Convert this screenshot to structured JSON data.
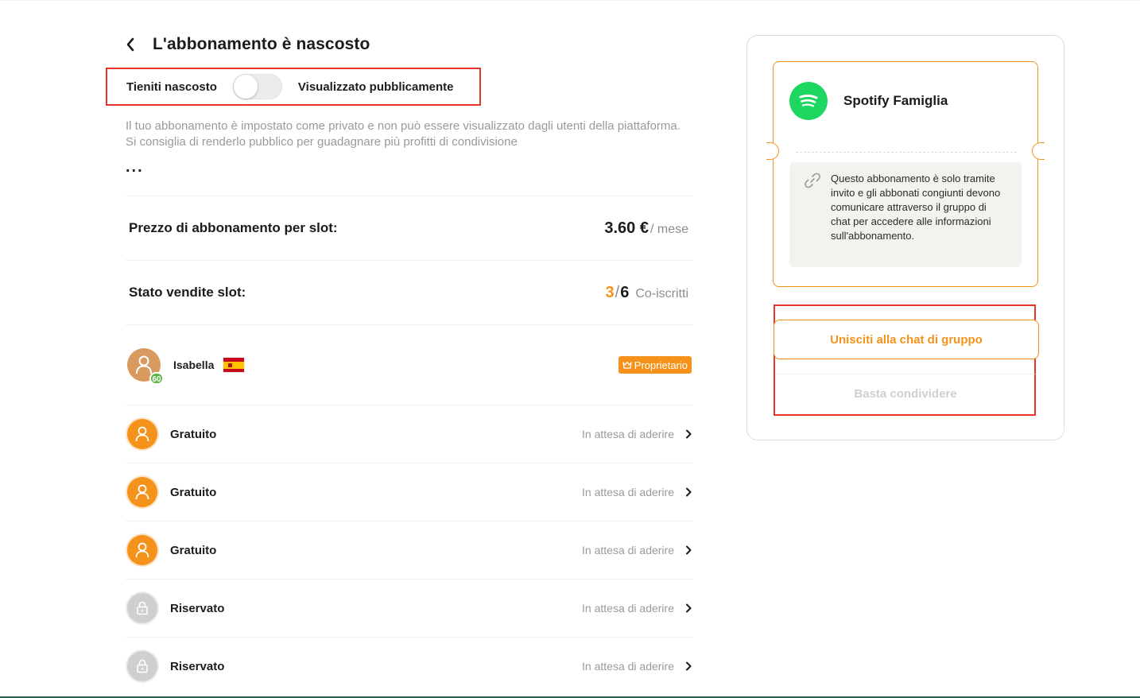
{
  "header": {
    "title": "L'abbonamento è nascosto"
  },
  "visibility": {
    "hidden_label": "Tieniti nascosto",
    "public_label": "Visualizzato pubblicamente"
  },
  "description": "Il tuo abbonamento è impostato come privato e non può essere visualizzato dagli utenti della piattaforma. Si consiglia di renderlo pubblico per guadagnare più profitti di condivisione",
  "more": "...",
  "price": {
    "label": "Prezzo di abbonamento per slot:",
    "value": "3.60 €",
    "unit": "/ mese"
  },
  "slots": {
    "label": "Stato vendite slot:",
    "sold": "3",
    "separator": "/",
    "total": "6",
    "unit": "Co-iscritti"
  },
  "owner": {
    "name": "Isabella",
    "level": "60",
    "badge": "Proprietario",
    "flag": "spain-flag"
  },
  "members": [
    {
      "name": "Gratuito",
      "status": "In attesa di aderire",
      "kind": "free"
    },
    {
      "name": "Gratuito",
      "status": "In attesa di aderire",
      "kind": "free"
    },
    {
      "name": "Gratuito",
      "status": "In attesa di aderire",
      "kind": "free"
    },
    {
      "name": "Riservato",
      "status": "In attesa di aderire",
      "kind": "reserved"
    },
    {
      "name": "Riservato",
      "status": "In attesa di aderire",
      "kind": "reserved"
    }
  ],
  "card": {
    "service_name": "Spotify Famiglia",
    "invite_text": "Questo abbonamento è solo tramite invito e gli abbonati congiunti devono comunicare attraverso il gruppo di chat per accedere alle informazioni sull'abbonamento.",
    "join_button": "Unisciti alla chat di gruppo",
    "stop_button": "Basta condividere"
  },
  "colors": {
    "accent": "#f5921b",
    "spotify": "#1ed760",
    "highlight": "#e8352a"
  }
}
